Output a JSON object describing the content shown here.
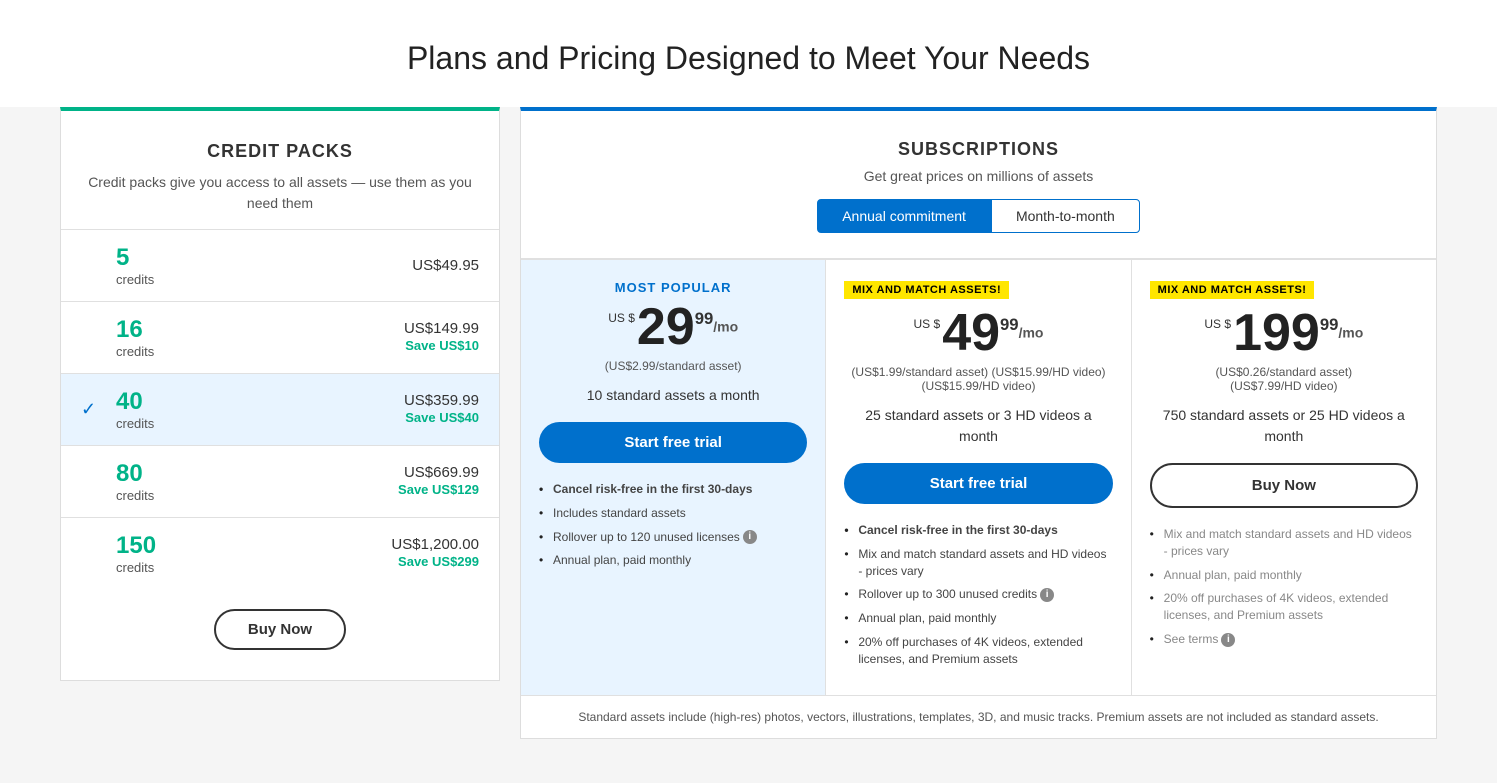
{
  "page": {
    "title": "Plans and Pricing Designed to Meet Your Needs"
  },
  "creditPacks": {
    "title": "CREDIT PACKS",
    "subtitle": "Credit packs give you access to all assets — use them as you need them",
    "packs": [
      {
        "credits": "5",
        "label": "credits",
        "price": "US$49.95",
        "save": null,
        "selected": false
      },
      {
        "credits": "16",
        "label": "credits",
        "price": "US$149.99",
        "save": "Save US$10",
        "selected": false
      },
      {
        "credits": "40",
        "label": "credits",
        "price": "US$359.99",
        "save": "Save US$40",
        "selected": true
      },
      {
        "credits": "80",
        "label": "credits",
        "price": "US$669.99",
        "save": "Save US$129",
        "selected": false
      },
      {
        "credits": "150",
        "label": "credits",
        "price": "US$1,200.00",
        "save": "Save US$299",
        "selected": false
      }
    ],
    "buyNow": "Buy Now"
  },
  "subscriptions": {
    "title": "SUBSCRIPTIONS",
    "subtitle": "Get great prices on millions of assets",
    "toggles": [
      {
        "label": "Annual commitment",
        "active": true
      },
      {
        "label": "Month-to-month",
        "active": false
      }
    ],
    "plans": [
      {
        "badge": "MOST POPULAR",
        "mixMatch": null,
        "currencyLabel": "US $",
        "amountWhole": "29",
        "amountCents": "99",
        "perMo": "/mo",
        "priceSub": "(US$2.99/standard asset)",
        "description": "10 standard assets a month",
        "cta": "Start free trial",
        "ctaStyle": "blue",
        "highlighted": true,
        "features": [
          {
            "text": "Cancel risk-free in the first 30-days",
            "bold": true
          },
          {
            "text": "Includes standard assets",
            "bold": false
          },
          {
            "text": "Rollover up to 120 unused licenses",
            "bold": false,
            "info": true
          },
          {
            "text": "Annual plan, paid monthly",
            "bold": false
          }
        ]
      },
      {
        "badge": null,
        "mixMatch": "MIX AND MATCH ASSETS!",
        "currencyLabel": "US $",
        "amountWhole": "49",
        "amountCents": "99",
        "perMo": "/mo",
        "priceSub": "(US$1.99/standard asset)\n(US$15.99/HD video)",
        "priceSub2": "(US$15.99/HD video)",
        "description": "25 standard assets or 3 HD videos a month",
        "cta": "Start free trial",
        "ctaStyle": "blue",
        "highlighted": false,
        "features": [
          {
            "text": "Cancel risk-free in the first 30-days",
            "bold": true
          },
          {
            "text": "Mix and match standard assets and HD videos - prices vary",
            "bold": false
          },
          {
            "text": "Rollover up to 300 unused credits",
            "bold": false,
            "info": true
          },
          {
            "text": "Annual plan, paid monthly",
            "bold": false
          },
          {
            "text": "20% off purchases of 4K videos, extended licenses, and Premium assets",
            "bold": false
          }
        ]
      },
      {
        "badge": null,
        "mixMatch": "MIX AND MATCH ASSETS!",
        "currencyLabel": "US $",
        "amountWhole": "199",
        "amountCents": "99",
        "perMo": "/mo",
        "priceSub": "(US$0.26/standard asset)",
        "priceSub2": "(US$7.99/HD video)",
        "description": "750 standard assets or 25 HD videos a month",
        "cta": "Buy Now",
        "ctaStyle": "outline",
        "highlighted": false,
        "features": [
          {
            "text": "Mix and match standard assets and HD videos - prices vary",
            "bold": false,
            "muted": true
          },
          {
            "text": "Annual plan, paid monthly",
            "bold": false,
            "muted": true
          },
          {
            "text": "20% off purchases of 4K videos, extended licenses, and Premium assets",
            "bold": false,
            "muted": true
          },
          {
            "text": "See terms",
            "bold": false,
            "muted": true,
            "info": true
          }
        ]
      }
    ],
    "footerNote": "Standard assets include (high-res) photos, vectors, illustrations, templates, 3D, and music tracks. Premium assets are not included as standard assets."
  }
}
